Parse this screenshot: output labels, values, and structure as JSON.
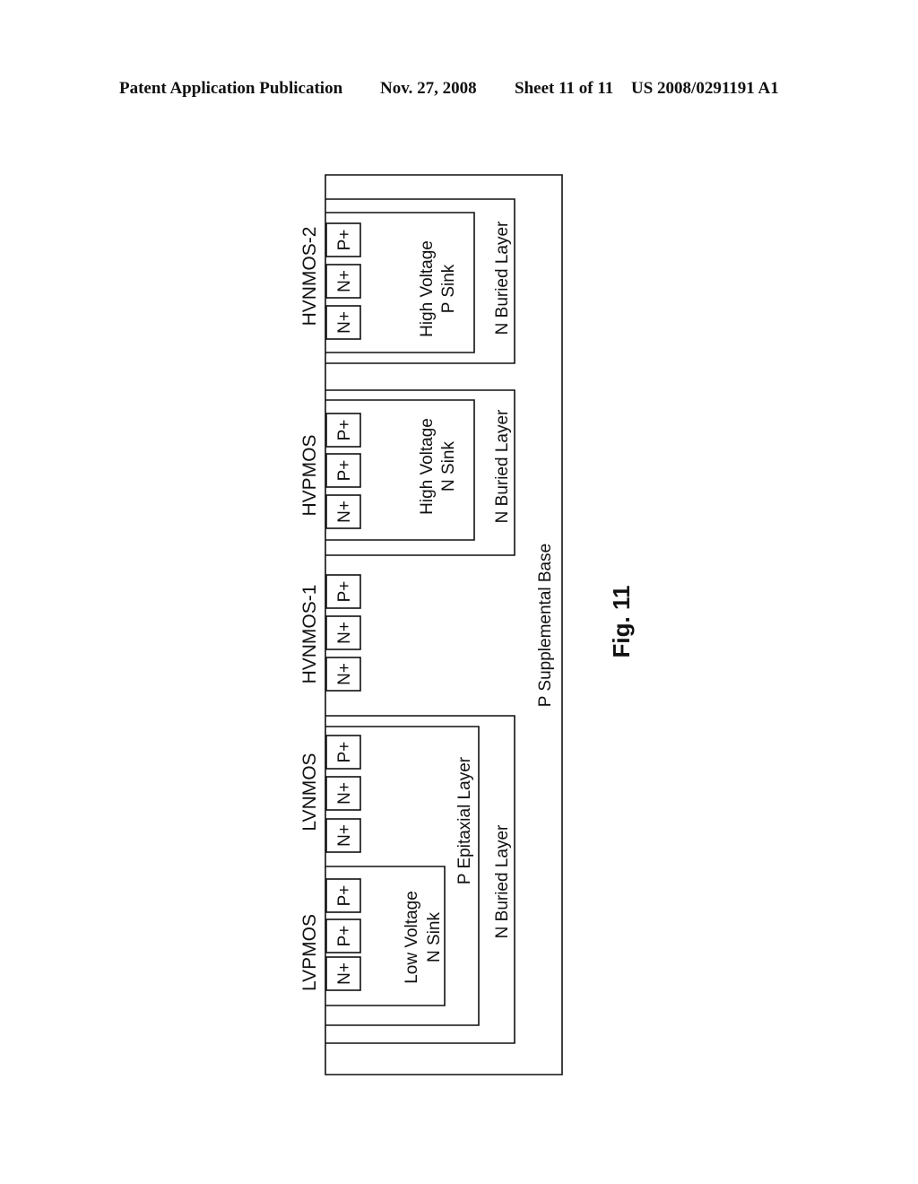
{
  "header": {
    "left": "Patent Application Publication",
    "date": "Nov. 27, 2008",
    "sheet": "Sheet 11 of 11",
    "number": "US 2008/0291191 A1"
  },
  "figure": {
    "caption": "Fig. 11",
    "substrate_label": "P Supplemental Base",
    "devices": [
      {
        "name": "LVPMOS",
        "terminals": [
          "N+",
          "P+",
          "P+"
        ],
        "well": [
          "Low Voltage",
          "N Sink"
        ]
      },
      {
        "name": "LVNMOS",
        "terminals": [
          "N+",
          "N+",
          "P+"
        ]
      },
      {
        "name": "HVNMOS-1",
        "terminals": [
          "N+",
          "N+",
          "P+"
        ]
      },
      {
        "name": "HVPMOS",
        "terminals": [
          "N+",
          "P+",
          "P+"
        ],
        "well": [
          "High Voltage",
          "N Sink"
        ]
      },
      {
        "name": "HVNMOS-2",
        "terminals": [
          "N+",
          "N+",
          "P+"
        ],
        "well": [
          "High Voltage",
          "P Sink"
        ]
      }
    ],
    "regions": {
      "lv_epi": "P Epitaxial Layer",
      "lv_buried": "N Buried Layer",
      "hvp_buried": "N Buried Layer",
      "hvn2_buried": "N Buried Layer"
    }
  }
}
